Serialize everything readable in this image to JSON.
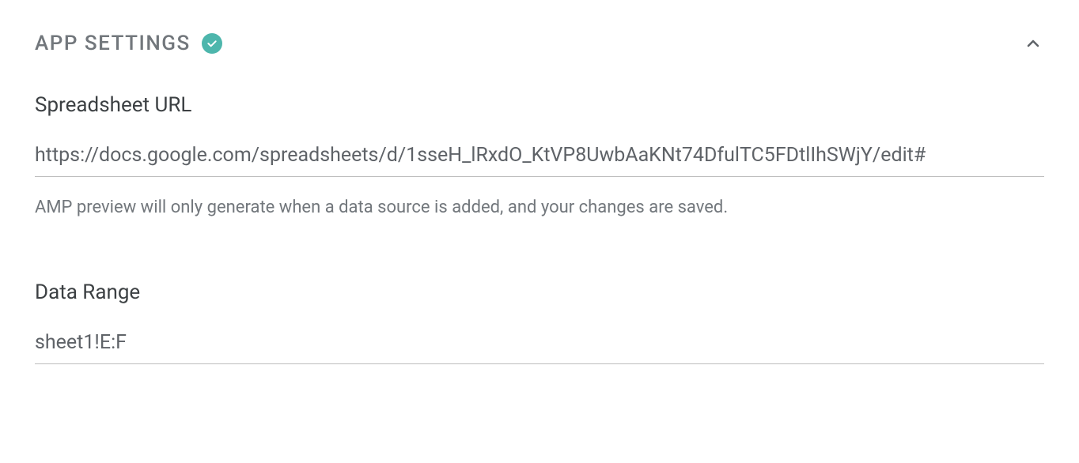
{
  "section": {
    "title": "APP SETTINGS"
  },
  "fields": {
    "spreadsheet": {
      "label": "Spreadsheet URL",
      "value": "https://docs.google.com/spreadsheets/d/1sseH_lRxdO_KtVP8UwbAaKNt74DfulTC5FDtlIhSWjY/edit#",
      "help": "AMP preview will only generate when a data source is added, and your changes are saved."
    },
    "dataRange": {
      "label": "Data Range",
      "value": "sheet1!E:F"
    }
  }
}
